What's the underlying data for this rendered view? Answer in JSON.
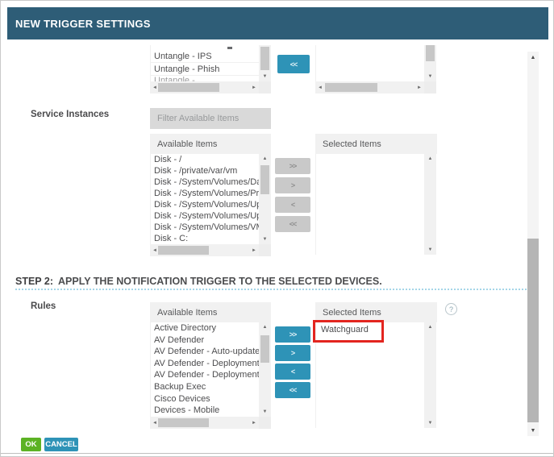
{
  "header": {
    "title": "NEW TRIGGER SETTINGS"
  },
  "icons": {
    "up_arrow": "▲",
    "down_arrow": "▼",
    "left_arrow": "◄",
    "right_arrow": "►",
    "help_icon": "?"
  },
  "top_section": {
    "left_list": {
      "items": [
        "Untangle - IPS",
        "Untangle - Phish"
      ],
      "partial_bottom_item": "Untangle -"
    },
    "move_all_left_label": "<<"
  },
  "service_instances": {
    "label": "Service Instances",
    "filter_placeholder": "Filter Available Items",
    "available_header": "Available Items",
    "available_items": [
      "Disk - /",
      "Disk - /private/var/vm",
      "Disk - /System/Volumes/Data",
      "Disk - /System/Volumes/Preboot",
      "Disk - /System/Volumes/Update",
      "Disk - /System/Volumes/Update/",
      "Disk - /System/Volumes/VM",
      "Disk - C:"
    ],
    "selected_header": "Selected Items",
    "selected_items": [],
    "buttons": {
      "move_all_right": ">>",
      "move_right": ">",
      "move_left": "<",
      "move_all_left": "<<"
    }
  },
  "step2": {
    "prefix": "STEP 2:",
    "text": "APPLY THE NOTIFICATION TRIGGER TO THE SELECTED DEVICES."
  },
  "rules": {
    "label": "Rules",
    "available_header": "Available Items",
    "available_items": [
      "Active Directory",
      "AV Defender",
      "AV Defender - Auto-update confi",
      "AV Defender - Deployment to Se",
      "AV Defender - Deployment to Wo",
      "Backup Exec",
      "Cisco Devices",
      "Devices - Mobile"
    ],
    "selected_header": "Selected Items",
    "selected_items": [
      "Watchguard"
    ],
    "buttons": {
      "move_all_right": ">>",
      "move_right": ">",
      "move_left": "<",
      "move_all_left": "<<"
    }
  },
  "footer": {
    "ok_label": "OK",
    "cancel_label": "CANCEL"
  },
  "colors": {
    "titlebar_bg": "#2E5D77",
    "accent_teal": "#2E93B7",
    "ok_green": "#5CB224",
    "disabled_gray": "#C9C9C9",
    "annotation_red": "#E3251F",
    "dotted_rule_blue": "#A5D6E8"
  }
}
